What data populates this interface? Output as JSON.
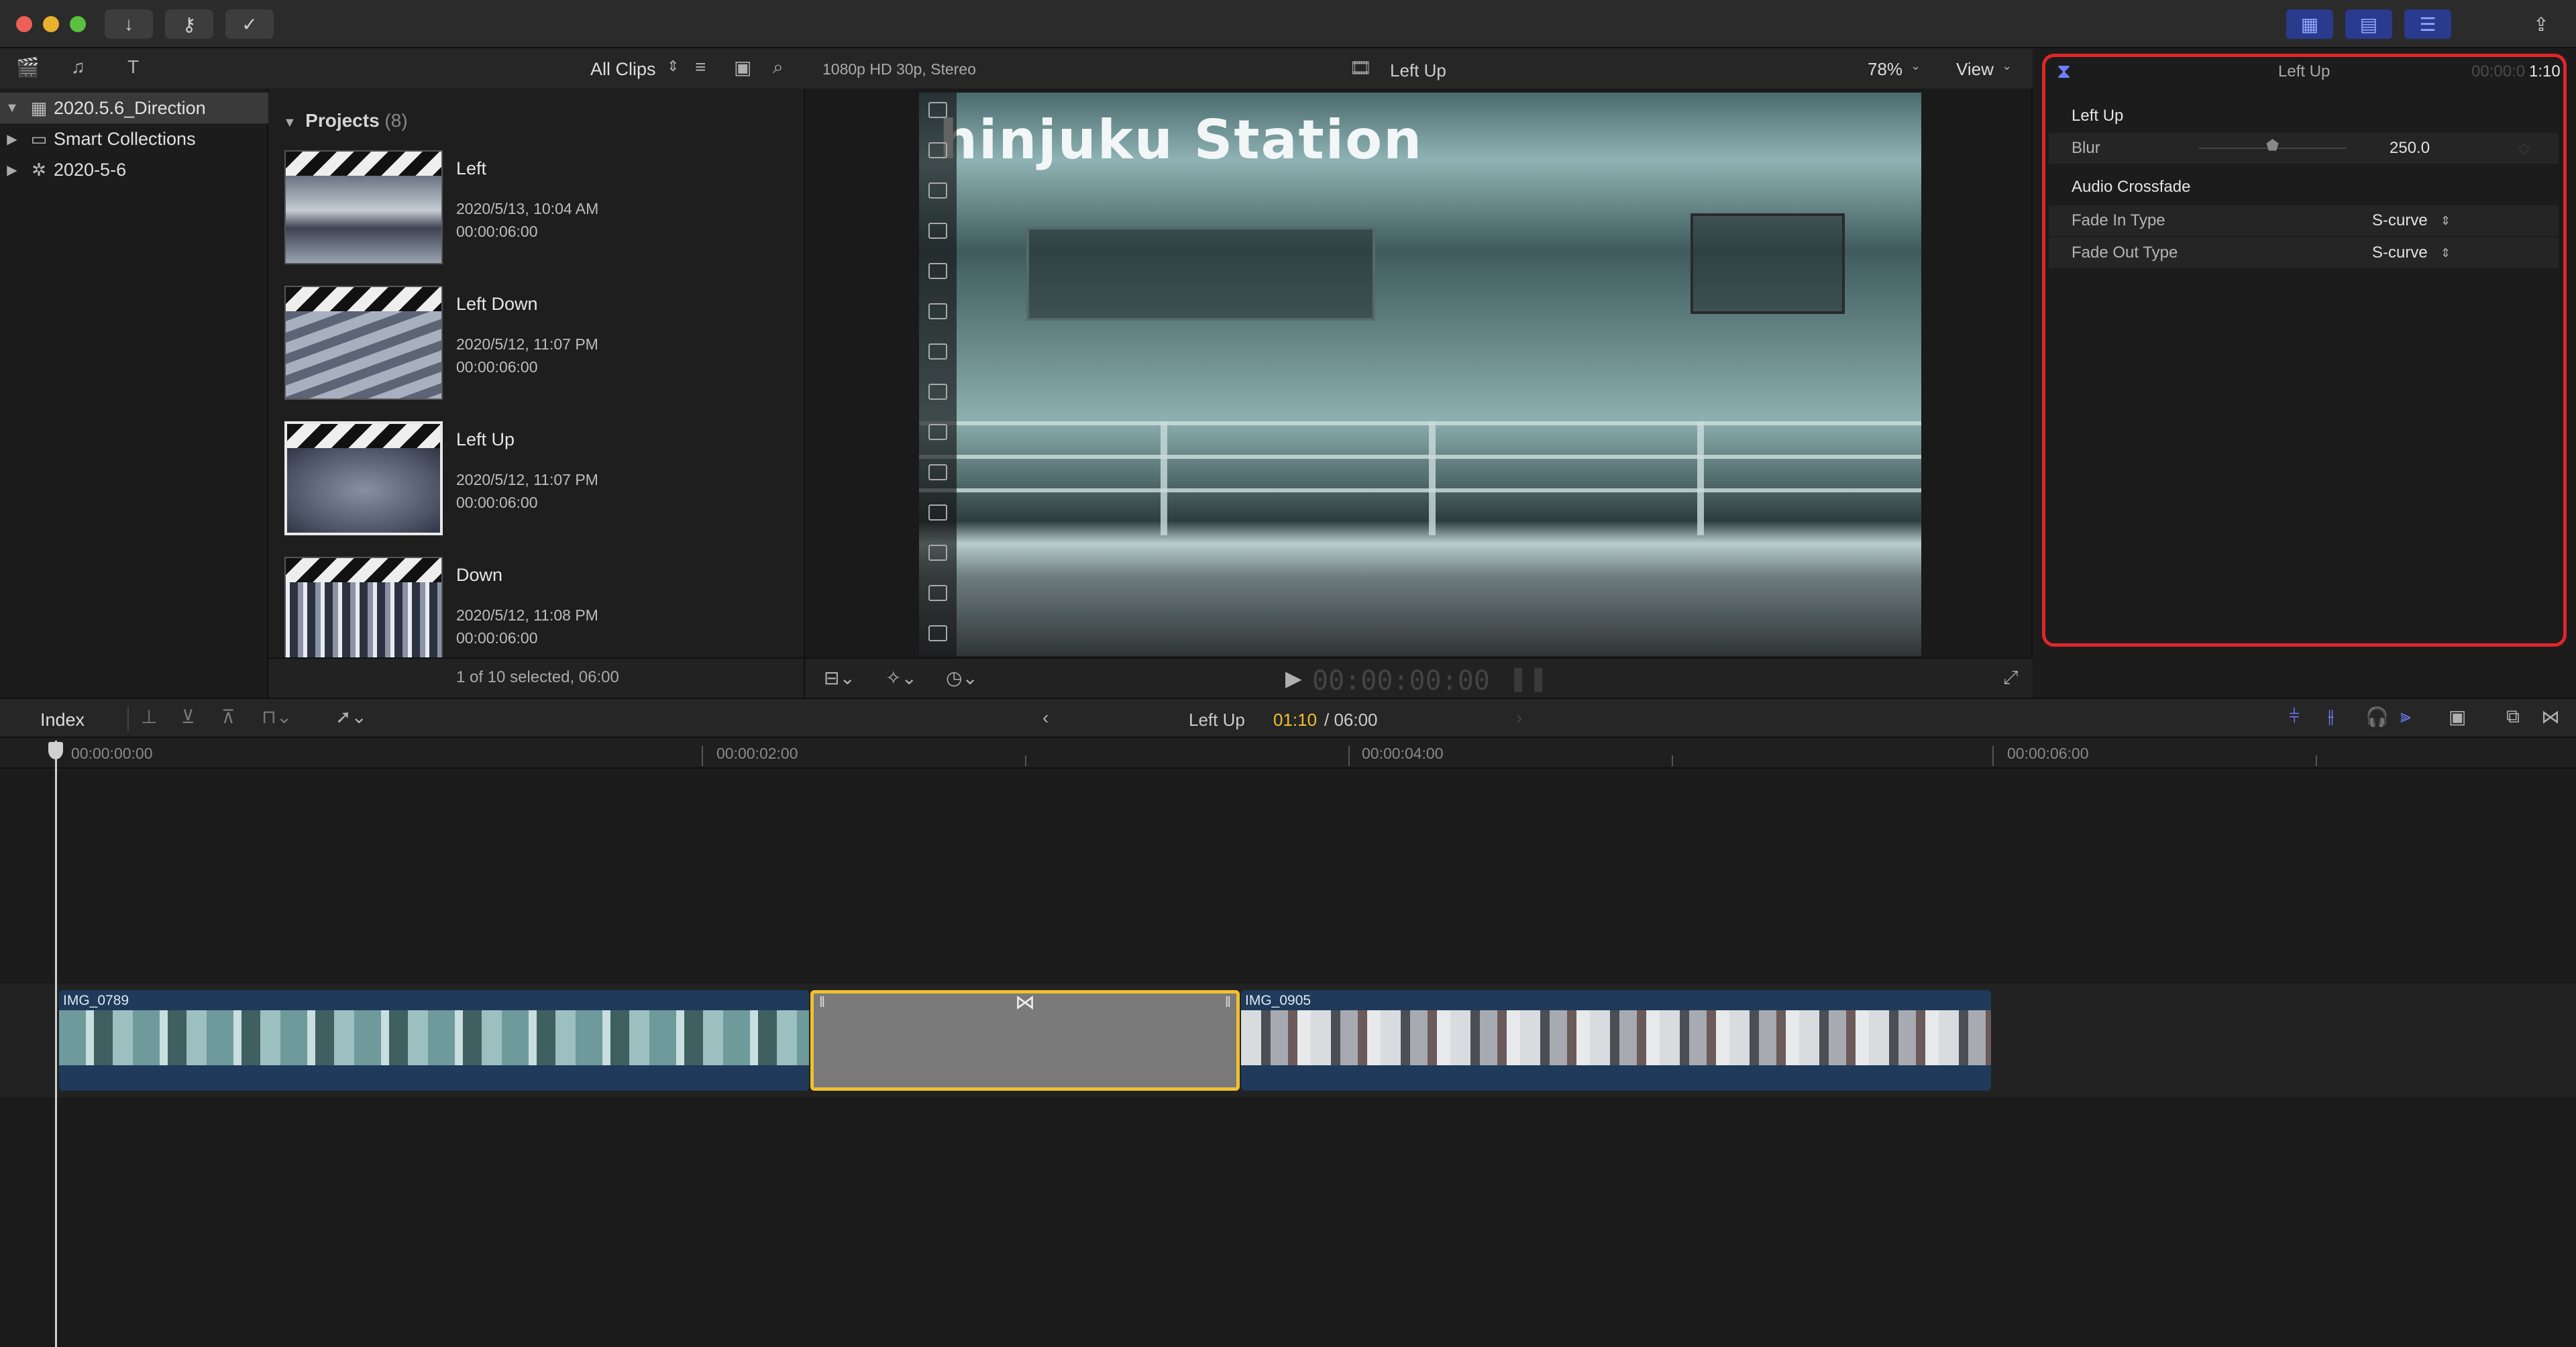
{
  "titlebar": {
    "icons": [
      "download-icon",
      "key-icon",
      "checkmark-circle-icon",
      "share-icon"
    ]
  },
  "library": {
    "items": [
      {
        "label": "2020.5.6_Direction",
        "selected": true
      },
      {
        "label": "Smart Collections"
      },
      {
        "label": "2020-5-6"
      }
    ]
  },
  "browser": {
    "filter_label": "All Clips",
    "section_title": "Projects",
    "section_count": "(8)",
    "projects": [
      {
        "name": "Left",
        "date": "2020/5/13, 10:04 AM",
        "duration": "00:00:06:00"
      },
      {
        "name": "Left Down",
        "date": "2020/5/12, 11:07 PM",
        "duration": "00:00:06:00"
      },
      {
        "name": "Left Up",
        "date": "2020/5/12, 11:07 PM",
        "duration": "00:00:06:00",
        "selected": true
      },
      {
        "name": "Down",
        "date": "2020/5/12, 11:08 PM",
        "duration": "00:00:06:00"
      }
    ],
    "footer": "1 of 10 selected, 06:00"
  },
  "viewer": {
    "format": "1080p HD 30p, Stereo",
    "title": "Left Up",
    "zoom": "78%",
    "view_label": "View",
    "timecode": "00:00:00:00",
    "sign_text": "hinjuku   Station"
  },
  "inspector": {
    "header_title": "Left Up",
    "header_timecode_dim": "00:00:0",
    "header_timecode": "1:10",
    "section1_title": "Left Up",
    "blur_label": "Blur",
    "blur_value": "250.0",
    "blur_level": 0.5,
    "section2_title": "Audio Crossfade",
    "fade_in_label": "Fade In Type",
    "fade_in_value": "S-curve",
    "fade_out_label": "Fade Out Type",
    "fade_out_value": "S-curve",
    "accent_color": "#e0262a"
  },
  "timeline": {
    "index_label": "Index",
    "project_name": "Left Up",
    "position": "01:10",
    "duration_text": "/ 06:00",
    "ruler": [
      "00:00:00:00",
      "00:00:02:00",
      "00:00:04:00",
      "00:00:06:00"
    ],
    "clips": [
      {
        "name": "IMG_0789"
      },
      {
        "name": "IMG_0905"
      }
    ],
    "transition_color": "#f0c030"
  }
}
